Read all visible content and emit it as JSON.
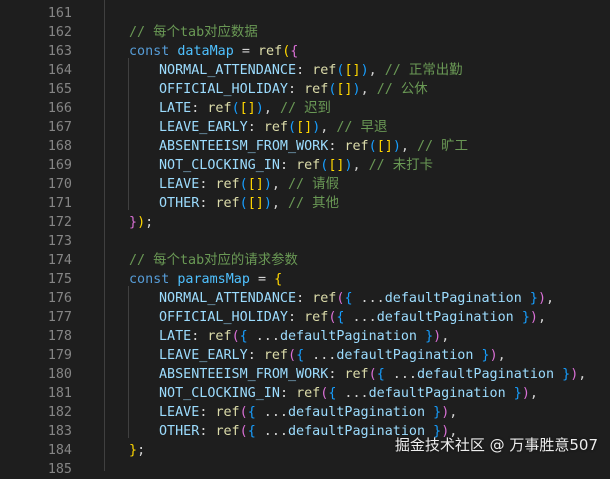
{
  "editor": {
    "lines": [
      {
        "num": "161",
        "tokens": []
      },
      {
        "num": "162",
        "tokens": [
          {
            "text": "// 每个tab对应数据",
            "kind": "comment"
          }
        ]
      },
      {
        "num": "163",
        "tokens": [
          {
            "text": "const ",
            "kind": "kw"
          },
          {
            "text": "dataMap",
            "kind": "var"
          },
          {
            "text": " = ",
            "kind": "plain"
          },
          {
            "text": "ref",
            "kind": "fn"
          },
          {
            "text": "(",
            "kind": "b1"
          },
          {
            "text": "{",
            "kind": "b2"
          }
        ]
      },
      {
        "num": "164",
        "tokens": [
          {
            "text": "NORMAL_ATTENDANCE",
            "kind": "prop"
          },
          {
            "text": ": ",
            "kind": "plain"
          },
          {
            "text": "ref",
            "kind": "fn"
          },
          {
            "text": "(",
            "kind": "b3"
          },
          {
            "text": "[]",
            "kind": "b1"
          },
          {
            "text": ")",
            "kind": "b3"
          },
          {
            "text": ", ",
            "kind": "plain"
          },
          {
            "text": "// 正常出勤",
            "kind": "comment"
          }
        ]
      },
      {
        "num": "165",
        "tokens": [
          {
            "text": "OFFICIAL_HOLIDAY",
            "kind": "prop"
          },
          {
            "text": ": ",
            "kind": "plain"
          },
          {
            "text": "ref",
            "kind": "fn"
          },
          {
            "text": "(",
            "kind": "b3"
          },
          {
            "text": "[]",
            "kind": "b1"
          },
          {
            "text": ")",
            "kind": "b3"
          },
          {
            "text": ", ",
            "kind": "plain"
          },
          {
            "text": "// 公休",
            "kind": "comment"
          }
        ]
      },
      {
        "num": "166",
        "tokens": [
          {
            "text": "LATE",
            "kind": "prop"
          },
          {
            "text": ": ",
            "kind": "plain"
          },
          {
            "text": "ref",
            "kind": "fn"
          },
          {
            "text": "(",
            "kind": "b3"
          },
          {
            "text": "[]",
            "kind": "b1"
          },
          {
            "text": ")",
            "kind": "b3"
          },
          {
            "text": ", ",
            "kind": "plain"
          },
          {
            "text": "// 迟到",
            "kind": "comment"
          }
        ]
      },
      {
        "num": "167",
        "tokens": [
          {
            "text": "LEAVE_EARLY",
            "kind": "prop"
          },
          {
            "text": ": ",
            "kind": "plain"
          },
          {
            "text": "ref",
            "kind": "fn"
          },
          {
            "text": "(",
            "kind": "b3"
          },
          {
            "text": "[]",
            "kind": "b1"
          },
          {
            "text": ")",
            "kind": "b3"
          },
          {
            "text": ", ",
            "kind": "plain"
          },
          {
            "text": "// 早退",
            "kind": "comment"
          }
        ]
      },
      {
        "num": "168",
        "tokens": [
          {
            "text": "ABSENTEEISM_FROM_WORK",
            "kind": "prop"
          },
          {
            "text": ": ",
            "kind": "plain"
          },
          {
            "text": "ref",
            "kind": "fn"
          },
          {
            "text": "(",
            "kind": "b3"
          },
          {
            "text": "[]",
            "kind": "b1"
          },
          {
            "text": ")",
            "kind": "b3"
          },
          {
            "text": ", ",
            "kind": "plain"
          },
          {
            "text": "// 旷工",
            "kind": "comment"
          }
        ]
      },
      {
        "num": "169",
        "tokens": [
          {
            "text": "NOT_CLOCKING_IN",
            "kind": "prop"
          },
          {
            "text": ": ",
            "kind": "plain"
          },
          {
            "text": "ref",
            "kind": "fn"
          },
          {
            "text": "(",
            "kind": "b3"
          },
          {
            "text": "[]",
            "kind": "b1"
          },
          {
            "text": ")",
            "kind": "b3"
          },
          {
            "text": ", ",
            "kind": "plain"
          },
          {
            "text": "// 未打卡",
            "kind": "comment"
          }
        ]
      },
      {
        "num": "170",
        "tokens": [
          {
            "text": "LEAVE",
            "kind": "prop"
          },
          {
            "text": ": ",
            "kind": "plain"
          },
          {
            "text": "ref",
            "kind": "fn"
          },
          {
            "text": "(",
            "kind": "b3"
          },
          {
            "text": "[]",
            "kind": "b1"
          },
          {
            "text": ")",
            "kind": "b3"
          },
          {
            "text": ", ",
            "kind": "plain"
          },
          {
            "text": "// 请假",
            "kind": "comment"
          }
        ]
      },
      {
        "num": "171",
        "tokens": [
          {
            "text": "OTHER",
            "kind": "prop"
          },
          {
            "text": ": ",
            "kind": "plain"
          },
          {
            "text": "ref",
            "kind": "fn"
          },
          {
            "text": "(",
            "kind": "b3"
          },
          {
            "text": "[]",
            "kind": "b1"
          },
          {
            "text": ")",
            "kind": "b3"
          },
          {
            "text": ", ",
            "kind": "plain"
          },
          {
            "text": "// 其他",
            "kind": "comment"
          }
        ]
      },
      {
        "num": "172",
        "tokens": [
          {
            "text": "}",
            "kind": "b2"
          },
          {
            "text": ")",
            "kind": "b1"
          },
          {
            "text": ";",
            "kind": "plain"
          }
        ]
      },
      {
        "num": "173",
        "tokens": []
      },
      {
        "num": "174",
        "tokens": [
          {
            "text": "// 每个tab对应的请求参数",
            "kind": "comment"
          }
        ]
      },
      {
        "num": "175",
        "tokens": [
          {
            "text": "const ",
            "kind": "kw"
          },
          {
            "text": "paramsMap",
            "kind": "var"
          },
          {
            "text": " = ",
            "kind": "plain"
          },
          {
            "text": "{",
            "kind": "b1"
          }
        ]
      },
      {
        "num": "176",
        "tokens": [
          {
            "text": "NORMAL_ATTENDANCE",
            "kind": "prop"
          },
          {
            "text": ": ",
            "kind": "plain"
          },
          {
            "text": "ref",
            "kind": "fn"
          },
          {
            "text": "(",
            "kind": "b2"
          },
          {
            "text": "{",
            "kind": "b3"
          },
          {
            "text": " ...",
            "kind": "plain"
          },
          {
            "text": "defaultPagination",
            "kind": "prop"
          },
          {
            "text": " ",
            "kind": "plain"
          },
          {
            "text": "}",
            "kind": "b3"
          },
          {
            "text": ")",
            "kind": "b2"
          },
          {
            "text": ",",
            "kind": "plain"
          }
        ]
      },
      {
        "num": "177",
        "tokens": [
          {
            "text": "OFFICIAL_HOLIDAY",
            "kind": "prop"
          },
          {
            "text": ": ",
            "kind": "plain"
          },
          {
            "text": "ref",
            "kind": "fn"
          },
          {
            "text": "(",
            "kind": "b2"
          },
          {
            "text": "{",
            "kind": "b3"
          },
          {
            "text": " ...",
            "kind": "plain"
          },
          {
            "text": "defaultPagination",
            "kind": "prop"
          },
          {
            "text": " ",
            "kind": "plain"
          },
          {
            "text": "}",
            "kind": "b3"
          },
          {
            "text": ")",
            "kind": "b2"
          },
          {
            "text": ",",
            "kind": "plain"
          }
        ]
      },
      {
        "num": "178",
        "tokens": [
          {
            "text": "LATE",
            "kind": "prop"
          },
          {
            "text": ": ",
            "kind": "plain"
          },
          {
            "text": "ref",
            "kind": "fn"
          },
          {
            "text": "(",
            "kind": "b2"
          },
          {
            "text": "{",
            "kind": "b3"
          },
          {
            "text": " ...",
            "kind": "plain"
          },
          {
            "text": "defaultPagination",
            "kind": "prop"
          },
          {
            "text": " ",
            "kind": "plain"
          },
          {
            "text": "}",
            "kind": "b3"
          },
          {
            "text": ")",
            "kind": "b2"
          },
          {
            "text": ",",
            "kind": "plain"
          }
        ]
      },
      {
        "num": "179",
        "tokens": [
          {
            "text": "LEAVE_EARLY",
            "kind": "prop"
          },
          {
            "text": ": ",
            "kind": "plain"
          },
          {
            "text": "ref",
            "kind": "fn"
          },
          {
            "text": "(",
            "kind": "b2"
          },
          {
            "text": "{",
            "kind": "b3"
          },
          {
            "text": " ...",
            "kind": "plain"
          },
          {
            "text": "defaultPagination",
            "kind": "prop"
          },
          {
            "text": " ",
            "kind": "plain"
          },
          {
            "text": "}",
            "kind": "b3"
          },
          {
            "text": ")",
            "kind": "b2"
          },
          {
            "text": ",",
            "kind": "plain"
          }
        ]
      },
      {
        "num": "180",
        "tokens": [
          {
            "text": "ABSENTEEISM_FROM_WORK",
            "kind": "prop"
          },
          {
            "text": ": ",
            "kind": "plain"
          },
          {
            "text": "ref",
            "kind": "fn"
          },
          {
            "text": "(",
            "kind": "b2"
          },
          {
            "text": "{",
            "kind": "b3"
          },
          {
            "text": " ...",
            "kind": "plain"
          },
          {
            "text": "defaultPagination",
            "kind": "prop"
          },
          {
            "text": " ",
            "kind": "plain"
          },
          {
            "text": "}",
            "kind": "b3"
          },
          {
            "text": ")",
            "kind": "b2"
          },
          {
            "text": ",",
            "kind": "plain"
          }
        ]
      },
      {
        "num": "181",
        "tokens": [
          {
            "text": "NOT_CLOCKING_IN",
            "kind": "prop"
          },
          {
            "text": ": ",
            "kind": "plain"
          },
          {
            "text": "ref",
            "kind": "fn"
          },
          {
            "text": "(",
            "kind": "b2"
          },
          {
            "text": "{",
            "kind": "b3"
          },
          {
            "text": " ...",
            "kind": "plain"
          },
          {
            "text": "defaultPagination",
            "kind": "prop"
          },
          {
            "text": " ",
            "kind": "plain"
          },
          {
            "text": "}",
            "kind": "b3"
          },
          {
            "text": ")",
            "kind": "b2"
          },
          {
            "text": ",",
            "kind": "plain"
          }
        ]
      },
      {
        "num": "182",
        "tokens": [
          {
            "text": "LEAVE",
            "kind": "prop"
          },
          {
            "text": ": ",
            "kind": "plain"
          },
          {
            "text": "ref",
            "kind": "fn"
          },
          {
            "text": "(",
            "kind": "b2"
          },
          {
            "text": "{",
            "kind": "b3"
          },
          {
            "text": " ...",
            "kind": "plain"
          },
          {
            "text": "defaultPagination",
            "kind": "prop"
          },
          {
            "text": " ",
            "kind": "plain"
          },
          {
            "text": "}",
            "kind": "b3"
          },
          {
            "text": ")",
            "kind": "b2"
          },
          {
            "text": ",",
            "kind": "plain"
          }
        ]
      },
      {
        "num": "183",
        "tokens": [
          {
            "text": "OTHER",
            "kind": "prop"
          },
          {
            "text": ": ",
            "kind": "plain"
          },
          {
            "text": "ref",
            "kind": "fn"
          },
          {
            "text": "(",
            "kind": "b2"
          },
          {
            "text": "{",
            "kind": "b3"
          },
          {
            "text": " ...",
            "kind": "plain"
          },
          {
            "text": "defaultPagination",
            "kind": "prop"
          },
          {
            "text": " ",
            "kind": "plain"
          },
          {
            "text": "}",
            "kind": "b3"
          },
          {
            "text": ")",
            "kind": "b2"
          },
          {
            "text": ",",
            "kind": "plain"
          }
        ]
      },
      {
        "num": "184",
        "tokens": [
          {
            "text": "}",
            "kind": "b1"
          },
          {
            "text": ";",
            "kind": "plain"
          }
        ]
      },
      {
        "num": "185",
        "tokens": []
      }
    ]
  },
  "watermark": {
    "text": "掘金技术社区 @ 万事胜意507"
  }
}
